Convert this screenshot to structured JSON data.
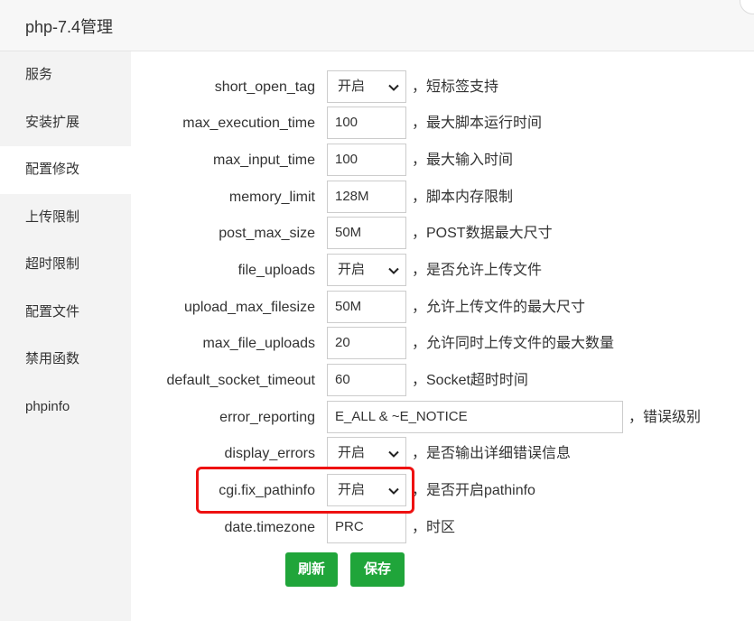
{
  "window": {
    "title": "php-7.4管理"
  },
  "sidebar": {
    "items": [
      {
        "label": "服务"
      },
      {
        "label": "安装扩展"
      },
      {
        "label": "配置修改"
      },
      {
        "label": "上传限制"
      },
      {
        "label": "超时限制"
      },
      {
        "label": "配置文件"
      },
      {
        "label": "禁用函数"
      },
      {
        "label": "phpinfo"
      }
    ],
    "active": "配置修改"
  },
  "settings": {
    "short_open_tag": {
      "label": "short_open_tag",
      "value": "开启",
      "desc": "，短标签支持"
    },
    "max_execution_time": {
      "label": "max_execution_time",
      "value": "100",
      "desc": "，最大脚本运行时间"
    },
    "max_input_time": {
      "label": "max_input_time",
      "value": "100",
      "desc": "，最大输入时间"
    },
    "memory_limit": {
      "label": "memory_limit",
      "value": "128M",
      "desc": "，脚本内存限制"
    },
    "post_max_size": {
      "label": "post_max_size",
      "value": "50M",
      "desc": "，POST数据最大尺寸"
    },
    "file_uploads": {
      "label": "file_uploads",
      "value": "开启",
      "desc": "，是否允许上传文件"
    },
    "upload_max_filesize": {
      "label": "upload_max_filesize",
      "value": "50M",
      "desc": "，允许上传文件的最大尺寸"
    },
    "max_file_uploads": {
      "label": "max_file_uploads",
      "value": "20",
      "desc": "，允许同时上传文件的最大数量"
    },
    "default_socket_timeout": {
      "label": "default_socket_timeout",
      "value": "60",
      "desc": "，Socket超时时间"
    },
    "error_reporting": {
      "label": "error_reporting",
      "value": "E_ALL & ~E_NOTICE",
      "desc": "，错误级别"
    },
    "display_errors": {
      "label": "display_errors",
      "value": "开启",
      "desc": "，是否输出详细错误信息"
    },
    "cgi_fix_pathinfo": {
      "label": "cgi.fix_pathinfo",
      "value": "开启",
      "desc": "，是否开启pathinfo"
    },
    "date_timezone": {
      "label": "date.timezone",
      "value": "PRC",
      "desc": "，时区"
    }
  },
  "buttons": {
    "refresh": "刷新",
    "save": "保存"
  },
  "colors": {
    "accent": "#20a53a",
    "highlight": "#ee1111"
  }
}
